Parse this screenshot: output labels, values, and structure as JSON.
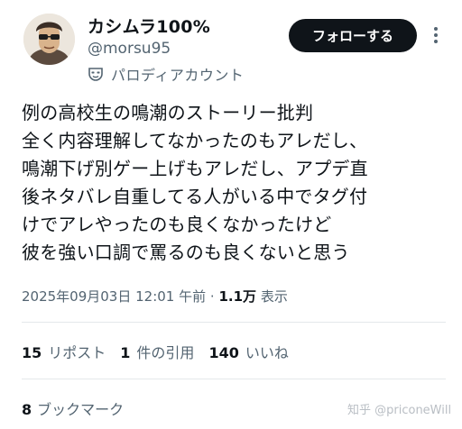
{
  "header": {
    "display_name": "カシムラ100%",
    "handle": "@morsu95",
    "parody_label": "パロディアカウント",
    "follow_label": "フォローする"
  },
  "tweet": {
    "lines": [
      "例の高校生の鳴潮のストーリー批判",
      "全く内容理解してなかったのもアレだし、",
      "鳴潮下げ別ゲー上げもアレだし、アプデ直",
      "後ネタバレ自重してる人がいる中でタグ付",
      "けでアレやったのも良くなかったけど",
      "彼を強い口調で罵るのも良くないと思う"
    ]
  },
  "meta": {
    "timestamp": "2025年09月03日 12:01 午前",
    "separator": "·",
    "views_count": "1.1万",
    "views_label": "表示"
  },
  "stats": {
    "reposts_count": "15",
    "reposts_label": "リポスト",
    "quotes_count": "1",
    "quotes_label": "件の引用",
    "likes_count": "140",
    "likes_label": "いいね",
    "bookmarks_count": "8",
    "bookmarks_label": "ブックマーク"
  },
  "watermark": "知乎 @priconeWill",
  "icons": {
    "avatar": "avatar-illustration",
    "parody": "mask-icon",
    "more": "more-vertical-icon"
  },
  "colors": {
    "primary_text": "#0f1419",
    "secondary_text": "#536471",
    "follow_button_bg": "#0f1419",
    "divider": "#e4e8eb"
  }
}
